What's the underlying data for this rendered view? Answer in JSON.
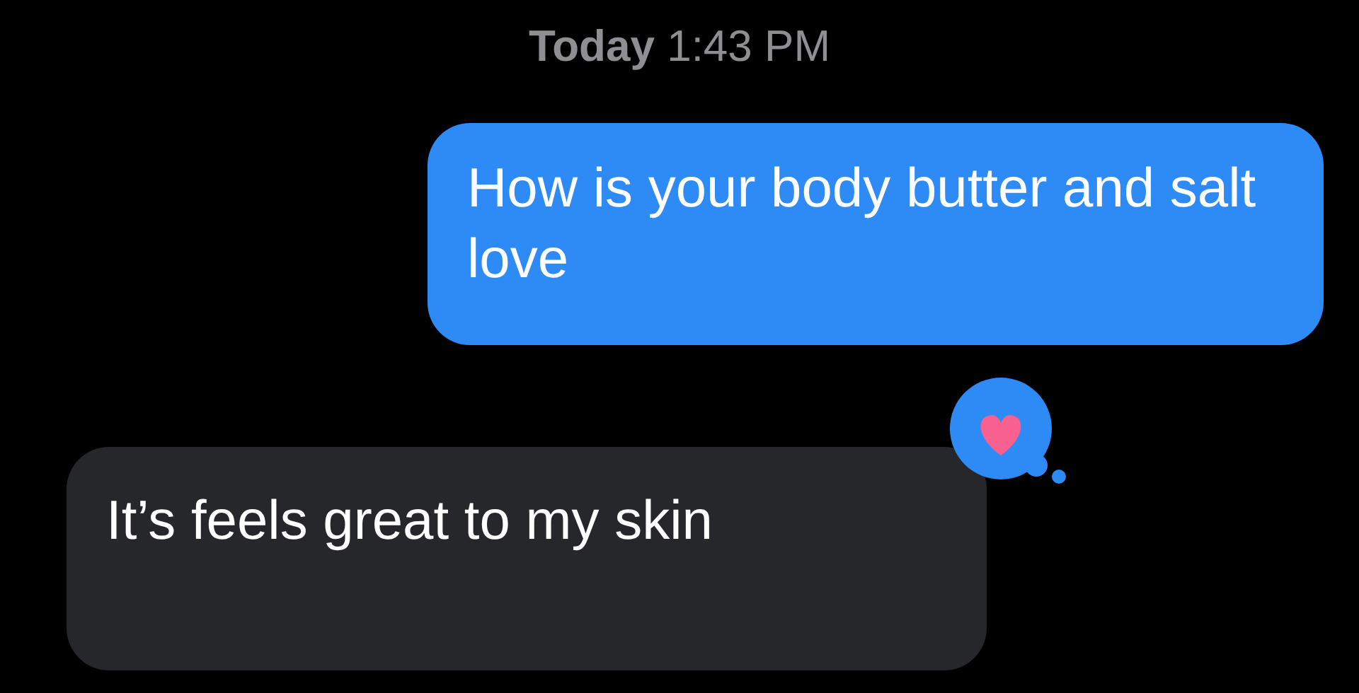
{
  "timestamp": "**Today** 1:43 PM",
  "messages": [
    {
      "kind": "sent",
      "text": "How is your body butter and salt love",
      "tapback": false
    },
    {
      "kind": "received",
      "text": "It’s feels great to my skin",
      "tapback": true
    }
  ]
}
